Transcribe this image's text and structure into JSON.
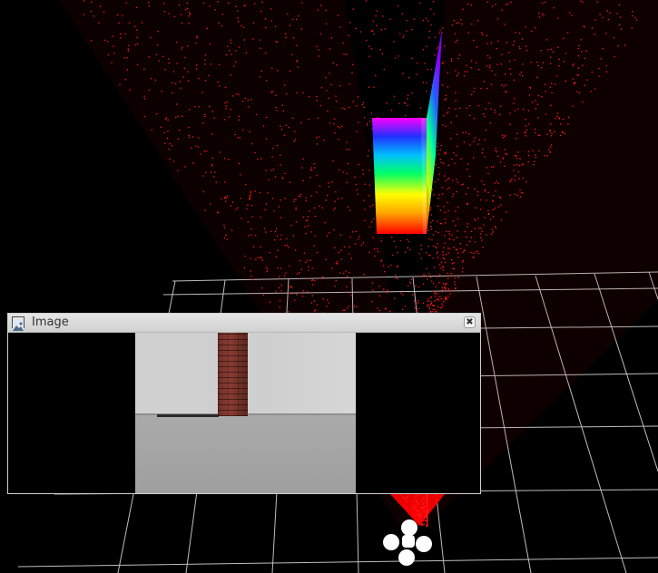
{
  "viewport": {
    "background": "#000000",
    "grid_color": "#bdbdbd",
    "laser_color": "#ff1a1a"
  },
  "image_panel": {
    "title": "Image",
    "close_glyph": "✖",
    "title_icon": "image-icon"
  },
  "camera_view": {
    "wall_color": "#d0d0d0",
    "floor_color": "#a5a5a5",
    "pillar_material": "brick"
  },
  "robot": {
    "icon": "quadcopter-marker-icon",
    "color": "#ffffff"
  },
  "point_cloud": {
    "colormap": "rainbow",
    "colors": [
      "#ff0000",
      "#ffa500",
      "#ffff00",
      "#00ff00",
      "#00bfff",
      "#0000ff",
      "#ff00ff"
    ]
  }
}
